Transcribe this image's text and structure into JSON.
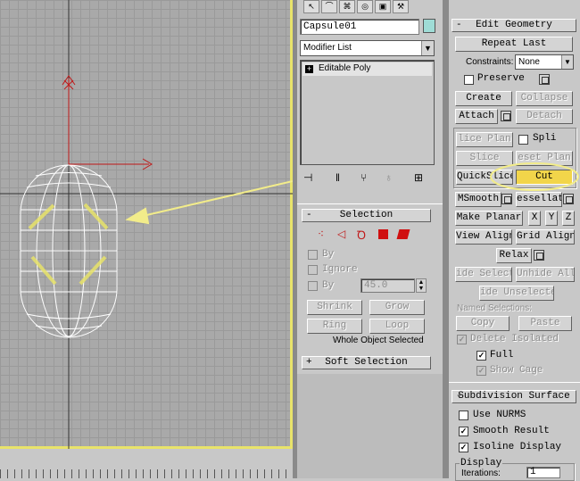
{
  "object_name": "Capsule01",
  "object_color": "#9fdcd6",
  "modifier_list": {
    "placeholder": "Modifier List"
  },
  "stack": {
    "items": [
      "Editable Poly"
    ]
  },
  "selection_rollout": {
    "title": "Selection",
    "sign": "-",
    "by_vertex_label": "By",
    "ignore_backfacing_label": "Ignore",
    "by_angle_label": "By",
    "angle_value": "45.0",
    "shrink_label": "Shrink",
    "grow_label": "Grow",
    "ring_label": "Ring",
    "loop_label": "Loop",
    "status": "Whole Object Selected"
  },
  "soft_selection_rollout": {
    "title": "Soft Selection",
    "sign": "+"
  },
  "edit_geometry": {
    "title": "Edit Geometry",
    "sign": "-",
    "repeat_last": "Repeat Last",
    "constraints_label": "Constraints:",
    "constraints_value": "None",
    "preserve_label": "Preserve",
    "create": "Create",
    "collapse": "Collapse",
    "attach": "Attach",
    "detach": "Detach",
    "slice_plane": "lice Plan",
    "split_label": "Spli",
    "slice": "Slice",
    "reset_plane": "eset Plan",
    "quickslice": "QuickSlice",
    "cut": "Cut",
    "msmooth": "MSmooth",
    "tessellate": "essellat",
    "make_planar": "Make Planar",
    "x": "X",
    "y": "Y",
    "z": "Z",
    "view_align": "View Align",
    "grid_align": "Grid Align",
    "relax": "Relax",
    "hide_selected": "ide Selecte",
    "unhide_all": "Unhide All",
    "hide_unselected": "ide Unselecte",
    "named_selections_label": "Named Selections:",
    "copy": "Copy",
    "paste": "Paste",
    "delete_isolated": "Delete Isolated",
    "full_label": "Full",
    "show_cage": "Show Cage"
  },
  "subdivision_surface": {
    "title": "Subdivision Surface",
    "sign": "-",
    "use_nurms": "Use NURMS",
    "smooth_result": "Smooth Result",
    "isoline_display": "Isoline Display",
    "display_group": "Display",
    "iterations_label": "Iterations:",
    "iterations_value": "1"
  },
  "colors": {
    "viewport_border": "#e8e36a",
    "highlight": "#f2d54a",
    "annotation": "#f2ec8a",
    "axis": "#c01818"
  }
}
